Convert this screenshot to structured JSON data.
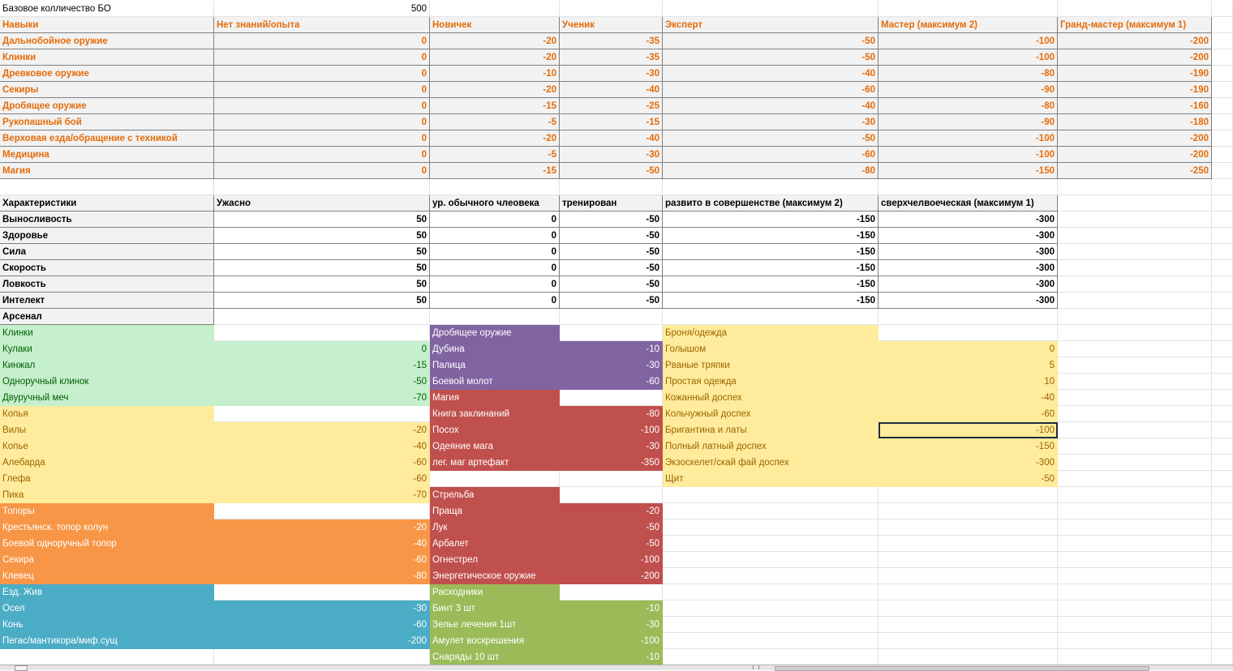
{
  "header": {
    "label": "Базовое колличество БО",
    "value": "500"
  },
  "skills": {
    "columns": [
      "Навыки",
      "Нет знаний/опыта",
      "Новичек",
      "Ученик",
      "Эксперт",
      "Мастер (максимум 2)",
      "Гранд-мастер (максимум 1)"
    ],
    "rows": [
      [
        "Дальнобойное оружие",
        "0",
        "-20",
        "-35",
        "-50",
        "-100",
        "-200"
      ],
      [
        "Клинки",
        "0",
        "-20",
        "-35",
        "-50",
        "-100",
        "-200"
      ],
      [
        "Древковое оружие",
        "0",
        "-10",
        "-30",
        "-40",
        "-80",
        "-190"
      ],
      [
        "Секиры",
        "0",
        "-20",
        "-40",
        "-60",
        "-90",
        "-190"
      ],
      [
        "Дробящее оружие",
        "0",
        "-15",
        "-25",
        "-40",
        "-80",
        "-160"
      ],
      [
        "Рукопашный бой",
        "0",
        "-5",
        "-15",
        "-30",
        "-90",
        "-180"
      ],
      [
        "Верховая езда/обращение с техникой",
        "0",
        "-20",
        "-40",
        "-50",
        "-100",
        "-200"
      ],
      [
        "Медицина",
        "0",
        "-5",
        "-30",
        "-60",
        "-100",
        "-200"
      ],
      [
        "Магия",
        "0",
        "-15",
        "-50",
        "-80",
        "-150",
        "-250"
      ]
    ]
  },
  "characteristics": {
    "columns": [
      "Характеристики",
      "Ужасно",
      "ур. обычного члеовека",
      "тренирован",
      "развито в совершенстве (максимум 2)",
      "сверхчелвоеческая (максимум 1)"
    ],
    "rows": [
      [
        "Выносливость",
        "50",
        "0",
        "-50",
        "-150",
        "-300"
      ],
      [
        "Здоровье",
        "50",
        "0",
        "-50",
        "-150",
        "-300"
      ],
      [
        "Сила",
        "50",
        "0",
        "-50",
        "-150",
        "-300"
      ],
      [
        "Скорость",
        "50",
        "0",
        "-50",
        "-150",
        "-300"
      ],
      [
        "Ловкость",
        "50",
        "0",
        "-50",
        "-150",
        "-300"
      ],
      [
        "Интелект",
        "50",
        "0",
        "-50",
        "-150",
        "-300"
      ]
    ],
    "arsenal_label": "Арсенал"
  },
  "arsenal": {
    "col1": [
      [
        "Клинки",
        ""
      ],
      [
        "Кулаки",
        "0"
      ],
      [
        "Кинжал",
        "-15"
      ],
      [
        "Одноручный клинок",
        "-50"
      ],
      [
        "Двуручный меч",
        "-70"
      ],
      [
        "Копья",
        ""
      ],
      [
        "Вилы",
        "-20"
      ],
      [
        "Копье",
        "-40"
      ],
      [
        "Алебарда",
        "-60"
      ],
      [
        "Глефа",
        "-60"
      ],
      [
        "Пика",
        "-70"
      ],
      [
        "Топоры",
        ""
      ],
      [
        "Крестьянск. топор колун",
        "-20"
      ],
      [
        "Боевой одноручный топор",
        "-40"
      ],
      [
        "Секира",
        "-60"
      ],
      [
        "Клевец",
        "-80"
      ],
      [
        "Езд. Жив",
        ""
      ],
      [
        "Осел",
        "-30"
      ],
      [
        "Конь",
        "-60"
      ],
      [
        "Пегас/мантикора/миф.сущ",
        "-200"
      ]
    ],
    "col2": [
      [
        "Дробящее оружие",
        ""
      ],
      [
        "Дубина",
        "-10"
      ],
      [
        "Палица",
        "-30"
      ],
      [
        "Боевой молот",
        "-60"
      ],
      [
        "Магия",
        ""
      ],
      [
        "Книга заклинаний",
        "-80"
      ],
      [
        "Посох",
        "-100"
      ],
      [
        "Одеяние мага",
        "-30"
      ],
      [
        "лег. маг артефакт",
        "-350"
      ],
      [
        "",
        ""
      ],
      [
        "Стрельба",
        ""
      ],
      [
        "Праща",
        "-20"
      ],
      [
        "Лук",
        "-50"
      ],
      [
        "Арбалет",
        "-50"
      ],
      [
        "Огнестрел",
        "-100"
      ],
      [
        "Энергетическое оружие",
        "-200"
      ],
      [
        "Расходники",
        ""
      ],
      [
        "Бинт 3 шт",
        "-10"
      ],
      [
        "Зелье лечения 1шт",
        "-30"
      ],
      [
        "Амулет воскрешения",
        "-100"
      ],
      [
        "Снаряды 10 шт",
        "-10"
      ]
    ],
    "col3": [
      [
        "Броня/одежда",
        ""
      ],
      [
        "Голышом",
        "0"
      ],
      [
        "Рваные тряпки",
        "5"
      ],
      [
        "Простая одежда",
        "10"
      ],
      [
        "Кожанный доспех",
        "-40"
      ],
      [
        "Кольчужный доспех",
        "-60"
      ],
      [
        "Бригантина и латы",
        "-100"
      ],
      [
        "Полный латный доспех",
        "-150"
      ],
      [
        "Экзоскелет/скай фай доспех",
        "-300"
      ],
      [
        "Щит",
        "-50"
      ]
    ]
  },
  "colors": {
    "skills_header": "#e46c0a",
    "clinks_group": "#c6efce",
    "spears_group": "#ffeb9c",
    "axes_group": "#f79646",
    "mounts_group": "#4bacc6",
    "crushing_group": "#8064a2",
    "magic_group": "#c0504d",
    "consumables_group": "#9bbb59",
    "armor_group": "#ffeb9c"
  }
}
